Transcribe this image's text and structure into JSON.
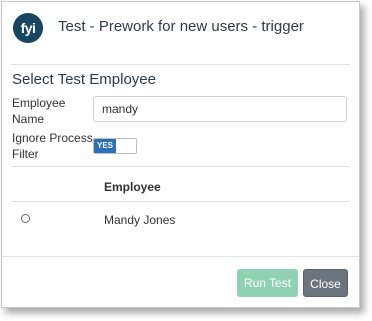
{
  "dialog": {
    "logo_text": "fyi",
    "title": "Test - Prework for new users - trigger"
  },
  "form": {
    "section_title": "Select Test Employee",
    "employee_name_label_line1": "Employee",
    "employee_name_label_line2": "Name",
    "employee_name_value": "mandy",
    "ignore_filter_label_line1": "Ignore Process",
    "ignore_filter_label_line2": "Filter",
    "ignore_filter_toggle": "YES"
  },
  "table": {
    "columns": [
      "",
      "Employee"
    ],
    "rows": [
      {
        "selected": false,
        "employee": "Mandy Jones"
      }
    ]
  },
  "footer": {
    "run_test_label": "Run Test",
    "close_label": "Close"
  },
  "colors": {
    "logo_bg": "#18455f",
    "toggle_on": "#2f6fb3",
    "run_test_disabled": "#8ed1b3",
    "close_bg": "#6c757d"
  }
}
